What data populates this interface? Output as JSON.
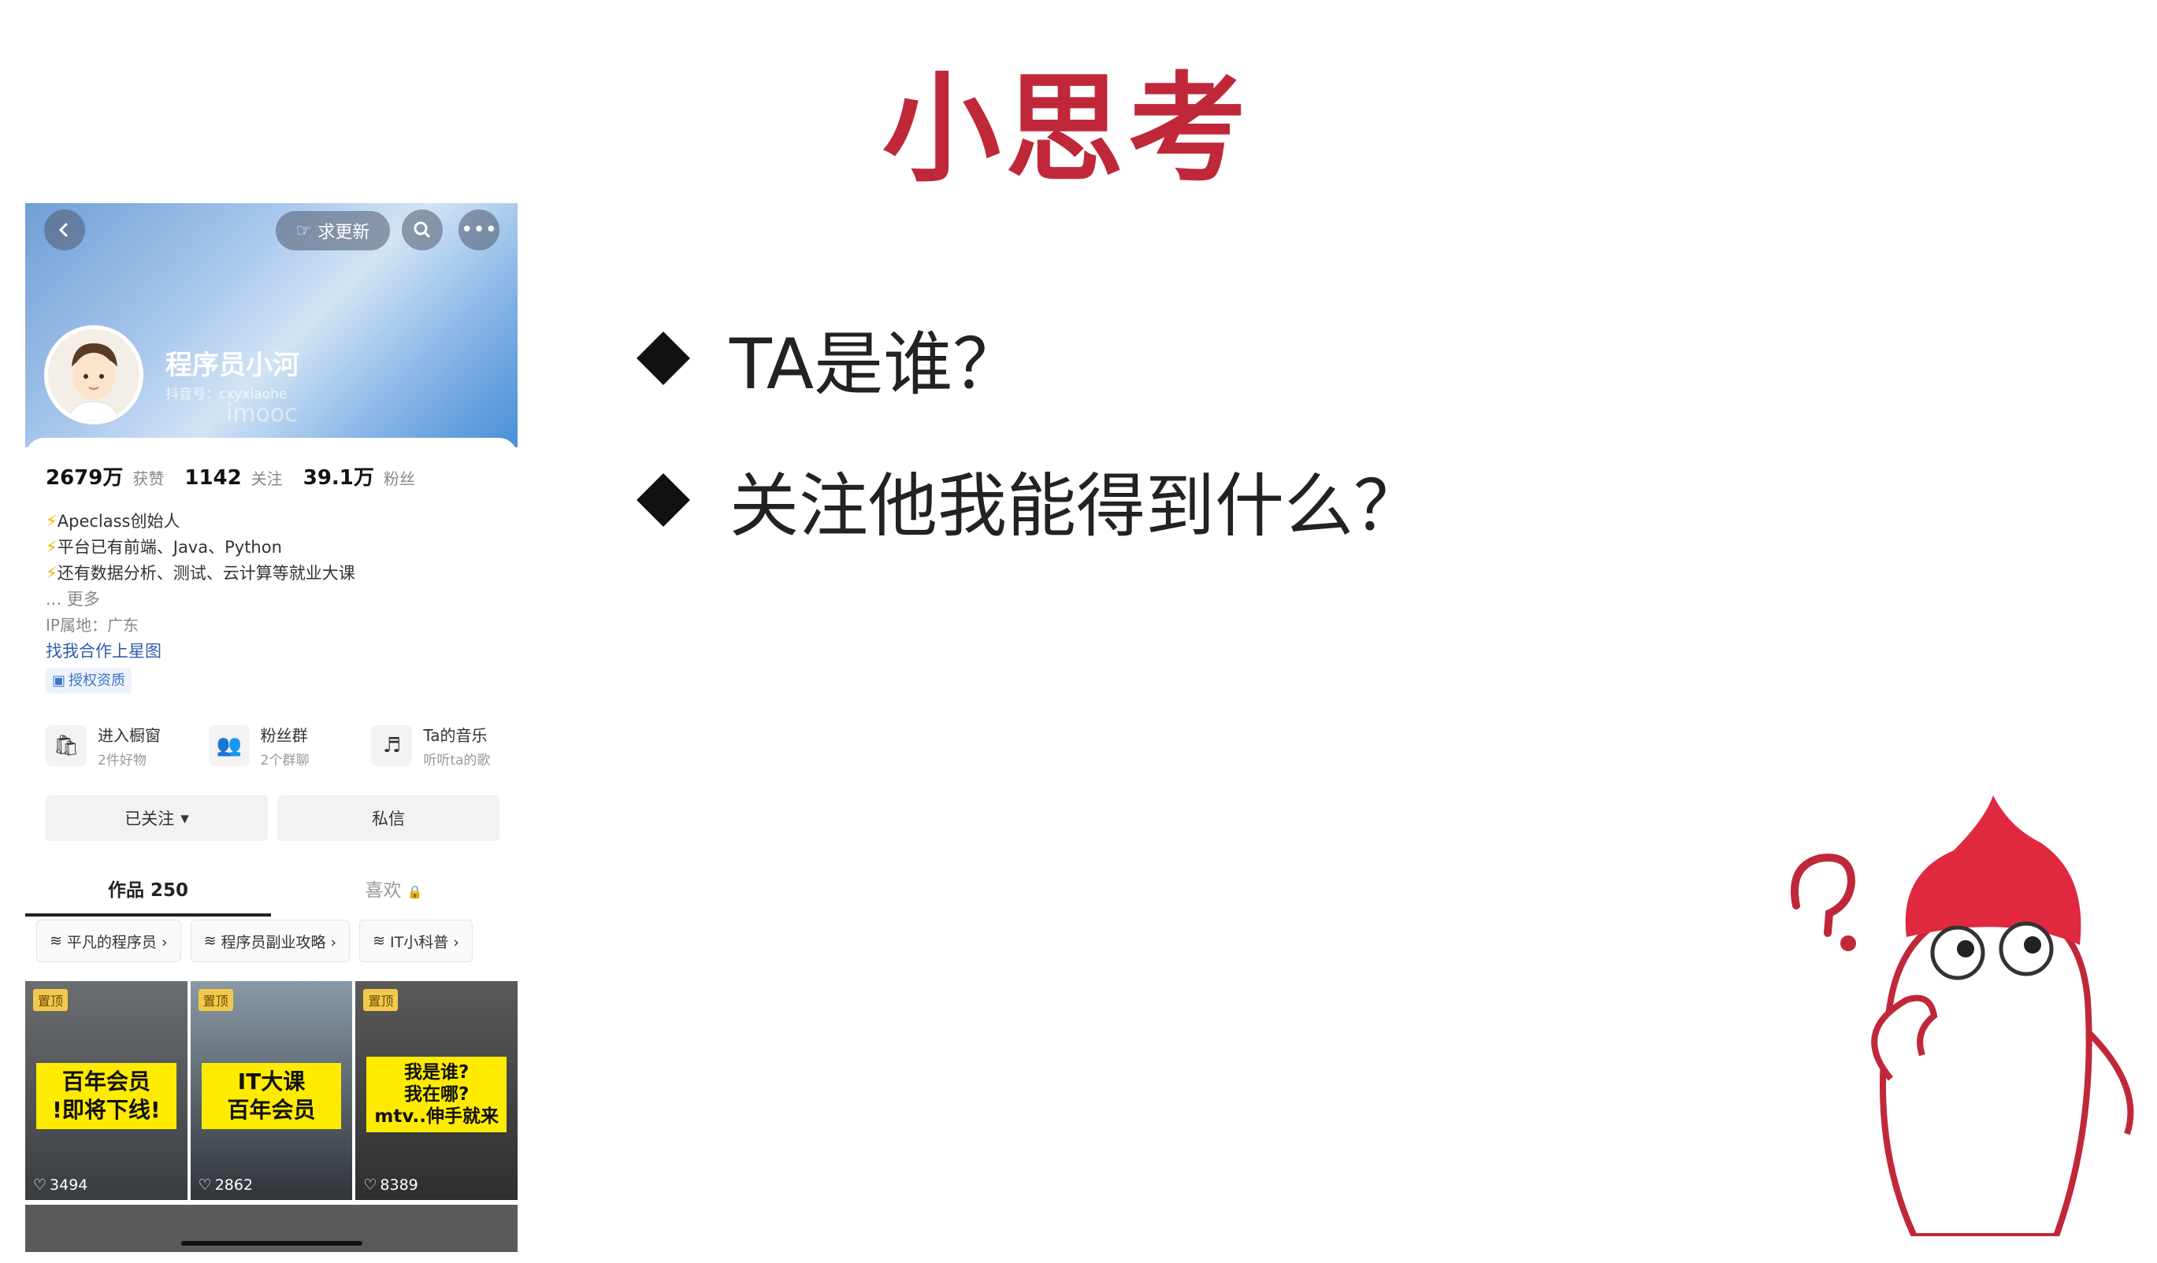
{
  "slide": {
    "title": "小思考",
    "bullets": [
      "TA是谁？",
      "关注他我能得到什么？"
    ]
  },
  "profile": {
    "request_update": "求更新",
    "name": "程序员小河",
    "douyin_id": "抖音号：cxyxiaohe",
    "watermark": "imooc",
    "stats": [
      {
        "num": "2679万",
        "label": "获赞"
      },
      {
        "num": "1142",
        "label": "关注"
      },
      {
        "num": "39.1万",
        "label": "粉丝"
      }
    ],
    "bio": [
      "Apeclass创始人",
      "平台已有前端、Java、Python",
      "还有数据分析、测试、云计算等就业大课"
    ],
    "more": "... 更多",
    "ip": "IP属地：广东",
    "star_link": "找我合作上星图",
    "auth": "授权资质",
    "entries": [
      {
        "title": "进入橱窗",
        "sub": "2件好物"
      },
      {
        "title": "粉丝群",
        "sub": "2个群聊"
      },
      {
        "title": "Ta的音乐",
        "sub": "听听ta的歌"
      }
    ],
    "followed": "已关注",
    "message": "私信",
    "tabs": [
      "作品 250",
      "喜欢"
    ],
    "collections": [
      "平凡的程序员 ›",
      "程序员副业攻略 ›",
      "IT小科普 ›"
    ],
    "videos": [
      {
        "pin": "置顶",
        "caption": "百年会员\n!即将下线!",
        "likes": "3494"
      },
      {
        "pin": "置顶",
        "caption": "IT大课\n百年会员",
        "likes": "2862"
      },
      {
        "pin": "置顶",
        "caption": "我是谁?\n我在哪?\nmtv..伸手就来",
        "likes": "8389"
      }
    ]
  }
}
